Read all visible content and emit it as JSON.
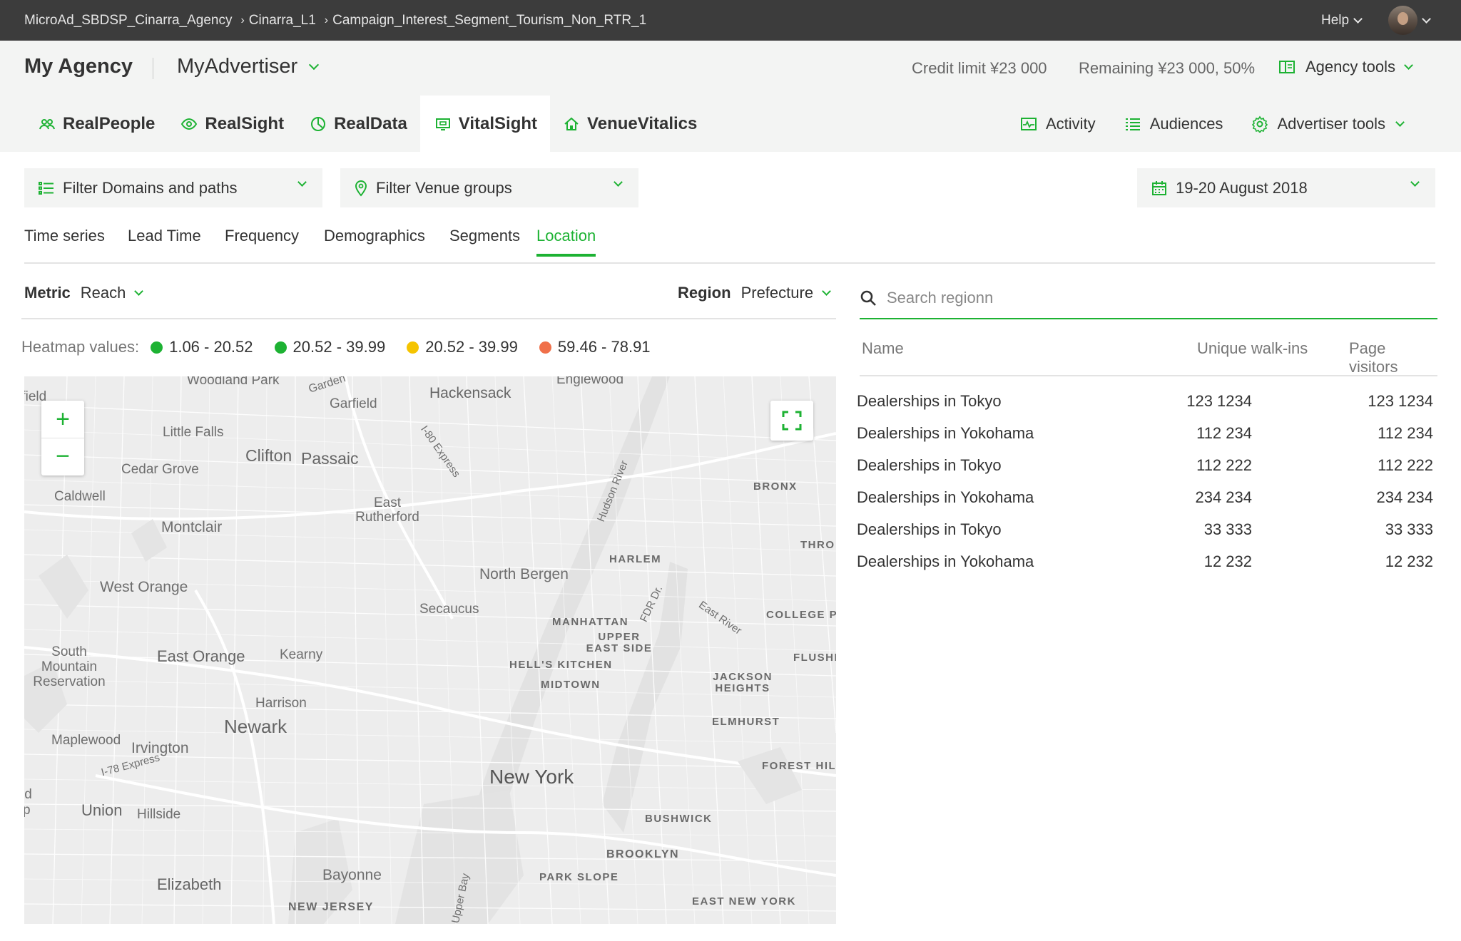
{
  "topbar": {
    "breadcrumbs": [
      "MicroAd_SBDSP_Cinarra_Agency",
      "Cinarra_L1",
      "Campaign_Interest_Segment_Tourism_Non_RTR_1"
    ],
    "help": "Help"
  },
  "header": {
    "agency": "My Agency",
    "advertiser": "MyAdvertiser",
    "credit_limit": "Credit limit ¥23 000",
    "remaining": "Remaining ¥23 000, 50%",
    "agency_tools": "Agency tools"
  },
  "nav": {
    "tabs": [
      {
        "label": "RealPeople",
        "icon": "people-icon"
      },
      {
        "label": "RealSight",
        "icon": "eye-icon"
      },
      {
        "label": "RealData",
        "icon": "pie-clock-icon"
      },
      {
        "label": "VitalSight",
        "icon": "monitor-icon",
        "active": true
      },
      {
        "label": "VenueVitalics",
        "icon": "home-icon"
      }
    ],
    "right": [
      {
        "label": "Activity",
        "icon": "activity-icon"
      },
      {
        "label": "Audiences",
        "icon": "list-icon"
      },
      {
        "label": "Advertiser tools",
        "icon": "gear-icon"
      }
    ]
  },
  "filters": {
    "domains": "Filter Domains and paths",
    "venues": "Filter Venue groups",
    "date": "19-20 August 2018"
  },
  "subtabs": [
    "Time series",
    "Lead Time",
    "Frequency",
    "Demographics",
    "Segments",
    "Location"
  ],
  "active_subtab": "Location",
  "metric": {
    "label": "Metric",
    "value": "Reach"
  },
  "region": {
    "label": "Region",
    "value": "Prefecture"
  },
  "legend": {
    "title": "Heatmap values:",
    "items": [
      {
        "range": "1.06 - 20.52",
        "color": "#1db233"
      },
      {
        "range": "20.52 - 39.99",
        "color": "#1db233"
      },
      {
        "range": "20.52 - 39.99",
        "color": "#f5c400"
      },
      {
        "range": "59.46 - 78.91",
        "color": "#f0704a"
      }
    ]
  },
  "map": {
    "labels": {
      "woodland_park": "Woodland Park",
      "garden": "Garden",
      "garfield": "Garfield",
      "hackensack": "Hackensack",
      "englewood": "Englewood",
      "i80": "I-80 Express",
      "little_falls": "Little Falls",
      "clifton": "Clifton",
      "passaic": "Passaic",
      "cedar_grove": "Cedar Grove",
      "caldwell": "Caldwell",
      "east_rutherford": "East Rutherford",
      "bronx": "BRONX",
      "hudson_river": "Hudson River",
      "montclair": "Montclair",
      "thro": "THRO",
      "harlem": "HARLEM",
      "north_bergen": "North Bergen",
      "west_orange": "West Orange",
      "fdr": "FDR Dr.",
      "east_river": "East River",
      "college": "COLLEGE PO",
      "secaucus": "Secaucus",
      "manhattan": "MANHATTAN",
      "upper_east": "UPPER EAST SIDE",
      "south_mountain": "South Mountain Reservation",
      "east_orange": "East Orange",
      "kearny": "Kearny",
      "hells_kitchen": "HELL'S KITCHEN",
      "flushing": "FLUSHI",
      "midtown": "MIDTOWN",
      "jackson": "JACKSON HEIGHTS",
      "harrison": "Harrison",
      "newark": "Newark",
      "elmhurst": "ELMHURST",
      "maplewood": "Maplewood",
      "irvington": "Irvington",
      "forest_hill": "FOREST HILL",
      "i78": "I-78 Express",
      "new_york": "New York",
      "union": "Union",
      "hillside": "Hillside",
      "bushwick": "BUSHWICK",
      "brooklyn": "BROOKLYN",
      "elizabeth": "Elizabeth",
      "bayonne": "Bayonne",
      "park_slope": "PARK SLOPE",
      "upper_bay": "Upper Bay",
      "new_jersey": "NEW JERSEY",
      "east_new_york": "EAST NEW YORK",
      "rfield": "rfield",
      "ld": "ld",
      "p": "p"
    },
    "zoom_in": "+",
    "zoom_out": "−"
  },
  "search": {
    "placeholder": "Search regionn"
  },
  "table": {
    "columns": [
      "Name",
      "Unique walk-ins",
      "Page visitors"
    ],
    "rows": [
      {
        "name": "Dealerships in Tokyo",
        "walkins": "123 1234",
        "visitors": "123 1234"
      },
      {
        "name": "Dealerships in Yokohama",
        "walkins": "112 234",
        "visitors": "112 234"
      },
      {
        "name": "Dealerships in Tokyo",
        "walkins": "112 222",
        "visitors": "112 222"
      },
      {
        "name": "Dealerships in Yokohama",
        "walkins": "234 234",
        "visitors": "234 234"
      },
      {
        "name": "Dealerships in Tokyo",
        "walkins": "33 333",
        "visitors": "33 333"
      },
      {
        "name": "Dealerships in Yokohama",
        "walkins": "12 232",
        "visitors": "12 232"
      }
    ]
  }
}
